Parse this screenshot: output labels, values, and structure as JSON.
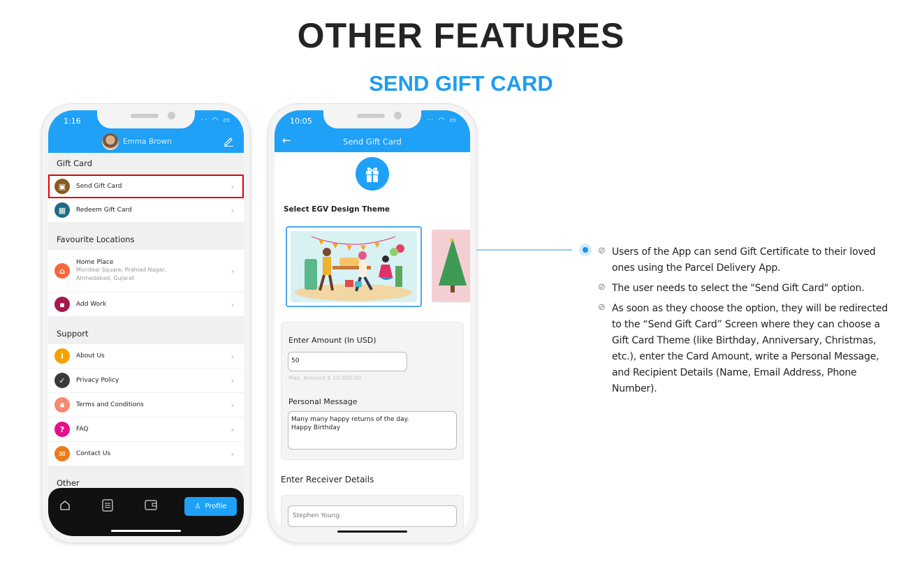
{
  "page": {
    "title": "OTHER FEATURES",
    "subtitle": "SEND GIFT CARD"
  },
  "phone1": {
    "time": "1:16",
    "user_name": "Emma Brown",
    "edit_icon": "pencil-icon",
    "sections": [
      {
        "title": "Gift Card",
        "items": [
          {
            "label": "Send Gift Card",
            "color": "#8b5a1e",
            "icon": "gift-icon",
            "selected": true
          },
          {
            "label": "Redeem Gift Card",
            "color": "#1d6b86",
            "icon": "gift-box-icon"
          }
        ]
      },
      {
        "title": "Favourite Locations",
        "items": [
          {
            "label": "Home Place",
            "sub": "Mondeal Square, Prahlad Nagar, Ahmedabad, Gujarat",
            "color": "#f5683d",
            "icon": "home-pin-icon"
          },
          {
            "label": "Add Work",
            "color": "#a4194c",
            "icon": "work-pin-icon"
          }
        ]
      },
      {
        "title": "Support",
        "items": [
          {
            "label": "About Us",
            "color": "#f5a100",
            "icon": "info-icon"
          },
          {
            "label": "Privacy Policy",
            "color": "#3a3a3a",
            "icon": "lock-check-icon"
          },
          {
            "label": "Terms and Conditions",
            "color": "#f58a6e",
            "icon": "lock-icon"
          },
          {
            "label": "FAQ",
            "color": "#e4128a",
            "icon": "question-icon"
          },
          {
            "label": "Contact Us",
            "color": "#ee7a1c",
            "icon": "mail-icon"
          }
        ]
      },
      {
        "title": "Other",
        "items": []
      }
    ],
    "nav": {
      "items": [
        "home-icon",
        "orders-icon",
        "wallet-icon"
      ],
      "active_label": "Profile"
    }
  },
  "phone2": {
    "time": "10:05",
    "header_title": "Send Gift Card",
    "theme_label": "Select EGV Design Theme",
    "themes": [
      "birthday",
      "christmas"
    ],
    "amount_label": "Enter Amount (In USD)",
    "amount_value": "50",
    "max_amount": "Max. Amount $ 10,000.00",
    "message_label": "Personal Message",
    "message_line1": "Many many happy returns of the day.",
    "message_line2": "Happy Birthday",
    "receiver_label": "Enter Receiver Details",
    "receiver_name": "Stephen Young"
  },
  "features": [
    "Users of the App can send Gift Certificate to their loved ones using the Parcel Delivery App.",
    "The user needs to select the \"Send Gift Card\" option.",
    "As soon as they choose the option, they will be redirected to the “Send Gift Card” Screen where they can choose a Gift Card Theme (like Birthday, Anniversary, Christmas, etc.), enter the Card Amount, write a Personal Message, and Recipient Details (Name, Email Address, Phone Number)."
  ],
  "colors": {
    "accent": "#1ea1f7",
    "title": "#242424",
    "highlight": "#e00000"
  }
}
